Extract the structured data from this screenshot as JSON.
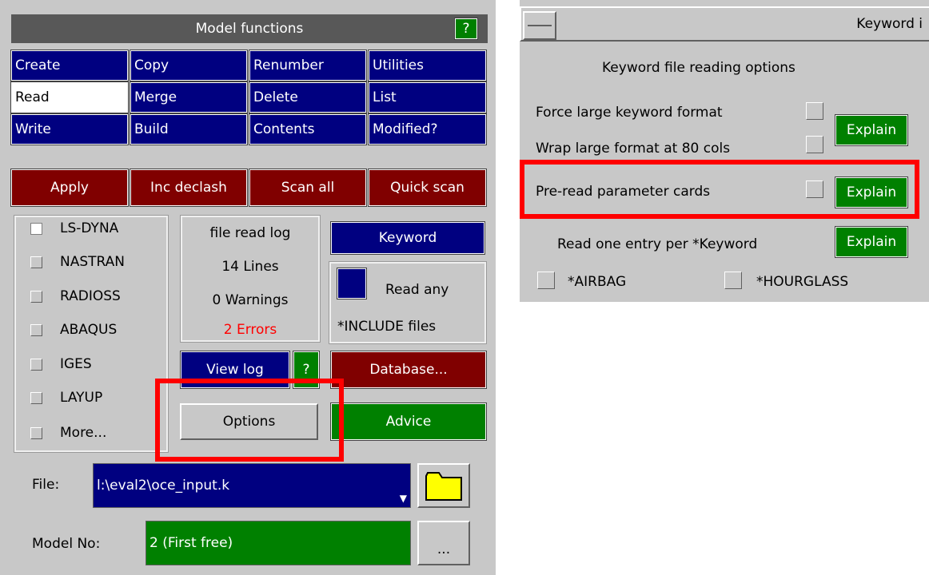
{
  "left": {
    "title": "Model functions",
    "help": "?",
    "grid": [
      [
        "Create",
        "Copy",
        "Renumber",
        "Utilities"
      ],
      [
        "Read",
        "Merge",
        "Delete",
        "List"
      ],
      [
        "Write",
        "Build",
        "Contents",
        "Modified?"
      ]
    ],
    "actions": [
      "Apply",
      "Inc declash",
      "Scan all",
      "Quick scan"
    ],
    "formats": [
      "LS-DYNA",
      "NASTRAN",
      "RADIOSS",
      "ABAQUS",
      "IGES",
      "LAYUP",
      "More..."
    ],
    "log": {
      "title": "file read log",
      "lines": "14 Lines",
      "warnings": "0 Warnings",
      "errors": "2 Errors"
    },
    "keyword": "Keyword",
    "read_any": "Read any",
    "include": "*INCLUDE files",
    "view_log": "View log",
    "help2": "?",
    "database": "Database...",
    "options": "Options",
    "advice": "Advice",
    "file_label": "File:",
    "file_value": "l:\\eval2\\oce_input.k",
    "model_label": "Model No:",
    "model_value": "2 (First free)",
    "ellipsis": "..."
  },
  "right": {
    "title": "Keyword i",
    "heading": "Keyword file reading options",
    "force": "Force large keyword format",
    "wrap": "Wrap large format at 80 cols",
    "explain": "Explain",
    "preread": "Pre-read parameter cards",
    "one_entry": "Read one entry per *Keyword",
    "airbag": "*AIRBAG",
    "hourglass": "*HOURGLASS"
  },
  "colors": {
    "blue": "#000080",
    "red": "#800000",
    "green": "#008000",
    "highlight": "#ff0000",
    "error_text": "#ff0000",
    "folder": "#ffff00"
  }
}
